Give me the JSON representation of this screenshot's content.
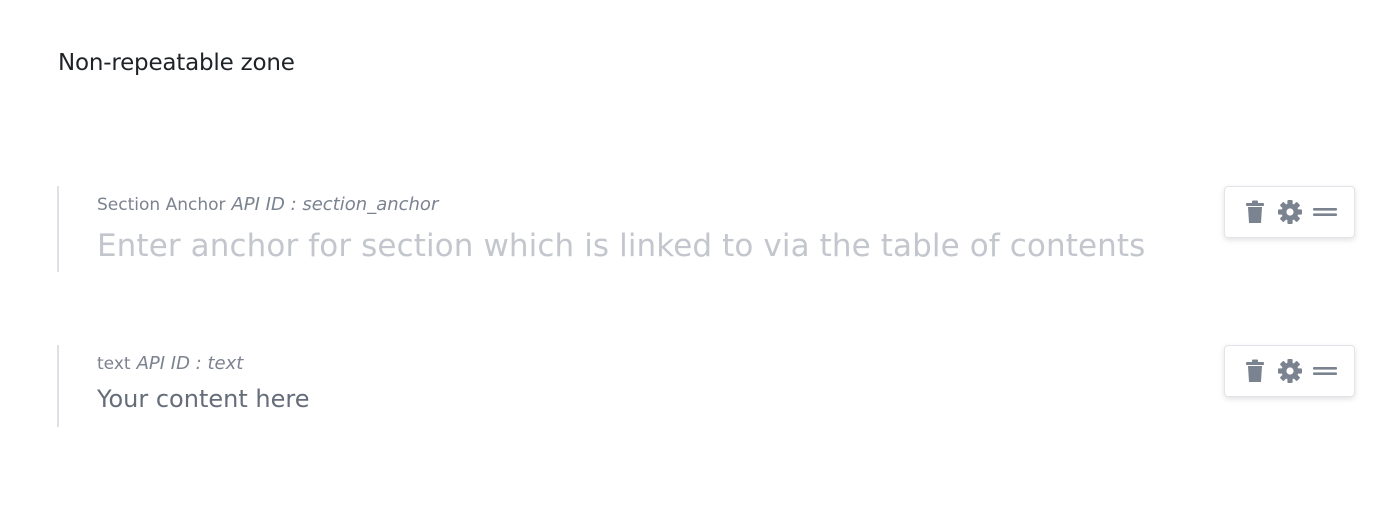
{
  "zone": {
    "title": "Non-repeatable zone"
  },
  "fields": [
    {
      "label": "Section Anchor",
      "api_id": "API ID : section_anchor",
      "placeholder": "Enter anchor for section which is linked to via the table of contents"
    },
    {
      "label": "text",
      "api_id": "API ID : text",
      "value": "Your content here"
    }
  ],
  "icons": {
    "delete": "trash-icon",
    "settings": "gear-icon",
    "drag": "drag-handle-icon"
  },
  "colors": {
    "icon": "#7b8390",
    "label": "#7b8390",
    "placeholder": "#c3c7cd",
    "value": "#656d7a",
    "divider": "#dde0e4"
  }
}
